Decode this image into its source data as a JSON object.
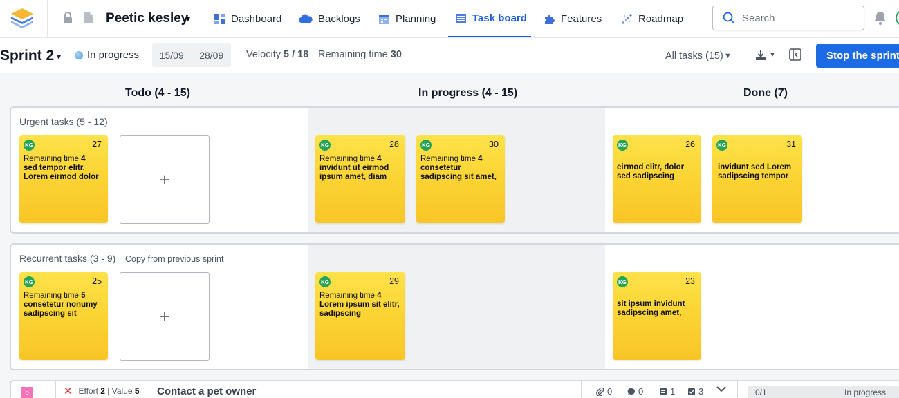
{
  "project": {
    "name": "Peetic kesley"
  },
  "nav": {
    "items": [
      {
        "label": "Dashboard",
        "icon": "dashboard-icon"
      },
      {
        "label": "Backlogs",
        "icon": "cloud-icon"
      },
      {
        "label": "Planning",
        "icon": "planning-icon"
      },
      {
        "label": "Task board",
        "icon": "task-board-icon",
        "active": true
      },
      {
        "label": "Features",
        "icon": "puzzle-icon"
      },
      {
        "label": "Roadmap",
        "icon": "roadmap-icon"
      }
    ],
    "search_placeholder": "Search"
  },
  "sprint": {
    "title": "Sprint 2",
    "status": "In progress",
    "start_date": "15/09",
    "end_date": "28/09",
    "velocity_label": "Velocity",
    "velocity_value": "5 / 18",
    "remaining_label": "Remaining time",
    "remaining_value": "30",
    "filter_label": "All tasks (15)",
    "stop_button": "Stop the sprint"
  },
  "columns": [
    {
      "label": "Todo (4 - 15)"
    },
    {
      "label": "In progress (4 - 15)"
    },
    {
      "label": "Done (7)"
    }
  ],
  "lanes": [
    {
      "title": "Urgent tasks (5 - 12)",
      "link": "",
      "cards": [
        {
          "initials": "KG",
          "number": "27",
          "remaining_label": "Remaining time",
          "remaining": "4",
          "text": "sed tempor elitr, Lorem eirmod dolor"
        },
        {
          "initials": "KG",
          "number": "28",
          "remaining_label": "Remaining time",
          "remaining": "4",
          "text": "invidunt ut eirmod ipsum amet, diam"
        },
        {
          "initials": "KG",
          "number": "30",
          "remaining_label": "Remaining time",
          "remaining": "4",
          "text": "consetetur sadipscing sit amet,"
        },
        {
          "initials": "KG",
          "number": "26",
          "text": "eirmod elitr, dolor sed sadipscing"
        },
        {
          "initials": "KG",
          "number": "31",
          "text": "invidunt sed Lorem sadipscing tempor"
        }
      ],
      "add_label": "+"
    },
    {
      "title": "Recurrent tasks (3 - 9)",
      "link": "Copy from previous sprint",
      "cards": [
        {
          "initials": "KG",
          "number": "25",
          "remaining_label": "Remaining time",
          "remaining": "5",
          "text": "consetetur nonumy sadipscing sit"
        },
        {
          "initials": "KG",
          "number": "29",
          "remaining_label": "Remaining time",
          "remaining": "4",
          "text": "Lorem ipsum sit elitr, sadipscing"
        },
        {
          "initials": "KG",
          "number": "23",
          "text": "sit ipsum invidunt sadipscing amet,"
        }
      ],
      "add_label": "+"
    }
  ],
  "bottom_story": {
    "id": "5",
    "effort_label": "Effort",
    "effort": "2",
    "value_label": "Value",
    "value": "5",
    "title": "Contact a pet owner",
    "attachments": "0",
    "comments": "0",
    "tasks": "1",
    "checks": "3",
    "progress_count": "0/1",
    "progress_status": "In progress"
  },
  "colors": {
    "accent": "#1d6ae5",
    "card_yellow": "#fcd535",
    "avatar_green": "#23a457",
    "in_progress_lane": "#f0f1f3"
  }
}
